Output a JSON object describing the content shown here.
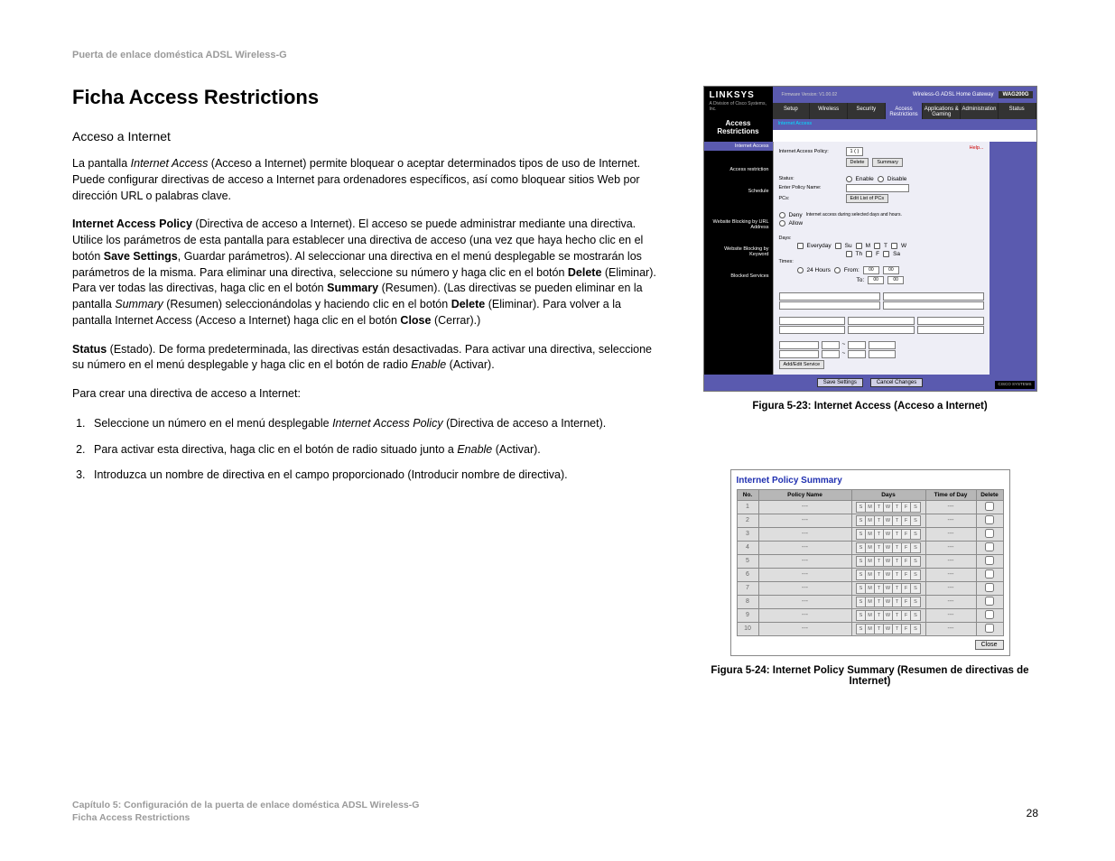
{
  "header": "Puerta de enlace doméstica ADSL Wireless-G",
  "title": "Ficha Access Restrictions",
  "subtitle": "Acceso a Internet",
  "para1_a": "La pantalla ",
  "para1_b": "Internet Access",
  "para1_c": " (Acceso a Internet) permite bloquear o aceptar determinados tipos de uso de Internet. Puede configurar directivas de acceso a Internet para ordenadores específicos, así como bloquear sitios Web por dirección URL o palabras clave.",
  "para2_a": "Internet Access Policy",
  "para2_b": " (Directiva de acceso a Internet). El acceso se puede administrar mediante una directiva. Utilice los parámetros de esta pantalla para establecer una directiva de acceso (una vez que haya hecho clic en el botón ",
  "para2_c": "Save Settings",
  "para2_d": ", Guardar parámetros). Al seleccionar una directiva en el menú desplegable se mostrarán los parámetros de la misma. Para eliminar una directiva, seleccione su número y haga clic en el botón ",
  "para2_e": "Delete",
  "para2_f": " (Eliminar). Para ver todas las directivas, haga clic en el botón ",
  "para2_g": "Summary",
  "para2_h": " (Resumen). (Las directivas se pueden eliminar en la pantalla ",
  "para2_i": "Summary",
  "para2_j": " (Resumen) seleccionándolas y haciendo clic en el botón ",
  "para2_k": "Delete",
  "para2_l": " (Eliminar). Para volver a la pantalla Internet Access (Acceso a Internet) haga clic en el botón ",
  "para2_m": "Close",
  "para2_n": " (Cerrar).)",
  "para3_a": "Status",
  "para3_b": " (Estado). De forma predeterminada, las directivas están desactivadas. Para activar una directiva, seleccione su número en el menú desplegable y haga clic en el botón de radio ",
  "para3_c": "Enable",
  "para3_d": " (Activar).",
  "para4": "Para crear una directiva de acceso a Internet:",
  "steps": {
    "s1a": "Seleccione un número en el menú desplegable ",
    "s1b": "Internet Access Policy",
    "s1c": " (Directiva de acceso a Internet).",
    "s2a": "Para activar esta directiva, haga clic en el botón de radio situado junto a ",
    "s2b": "Enable",
    "s2c": " (Activar).",
    "s3": "Introduzca un nombre de directiva en el campo proporcionado (Introducir nombre de directiva)."
  },
  "fig23_caption": "Figura 5-23: Internet Access (Acceso a Internet)",
  "fig24_caption": "Figura 5-24: Internet Policy Summary (Resumen de directivas de Internet)",
  "footer_line1": "Capítulo 5: Configuración de la puerta de enlace doméstica ADSL Wireless-G",
  "footer_line2": "Ficha Access Restrictions",
  "page_number": "28",
  "router": {
    "brand": "LINKSYS",
    "brandsub": "A Division of Cisco Systems, Inc.",
    "fw": "Firmware Version: V1.00.02",
    "model_label": "Wireless-G ADSL Home Gateway",
    "model": "WAG200G",
    "left_label_1": "Access",
    "left_label_2": "Restrictions",
    "tabs": [
      "Setup",
      "Wireless",
      "Security",
      "Access Restrictions",
      "Applications & Gaming",
      "Administration",
      "Status"
    ],
    "subtab": "Internet Access",
    "sidebar": [
      "Internet Access",
      "",
      "Access restriction",
      "Schedule",
      "",
      "Website Blocking by URL Address",
      "Website Blocking by Keyword",
      "Blocked Services"
    ],
    "help": "Help...",
    "policylabel": "Internet Access Policy:",
    "policyval": "1 ( )",
    "delete": "Delete",
    "summary": "Summary",
    "status": "Status:",
    "enable": "Enable",
    "disable": "Disable",
    "entername": "Enter Policy Name:",
    "pcs": "PCs:",
    "editlist": "Edit List of PCs",
    "deny": "Deny",
    "allow": "Allow",
    "denytext": "Internet access during selected days and hours.",
    "days": "Days:",
    "everyday": "Everyday",
    "d_su": "Su",
    "d_m": "M",
    "d_t": "T",
    "d_w": "W",
    "d_th": "Th",
    "d_f": "F",
    "d_sa": "Sa",
    "times": "Times:",
    "h24": "24 Hours",
    "from": "From:",
    "to": "To:",
    "hh": "00",
    "mm": "00",
    "addedit": "Add/Edit Service",
    "save": "Save Settings",
    "cancel": "Cancel Changes",
    "cisco": "CISCO SYSTEMS"
  },
  "summary": {
    "title": "Internet Policy Summary",
    "cols": [
      "No.",
      "Policy Name",
      "Days",
      "Time of Day",
      "Delete"
    ],
    "days": [
      "S",
      "M",
      "T",
      "W",
      "T",
      "F",
      "S"
    ],
    "rows": [
      "1",
      "2",
      "3",
      "4",
      "5",
      "6",
      "7",
      "8",
      "9",
      "10"
    ],
    "dash": "---",
    "close": "Close"
  }
}
